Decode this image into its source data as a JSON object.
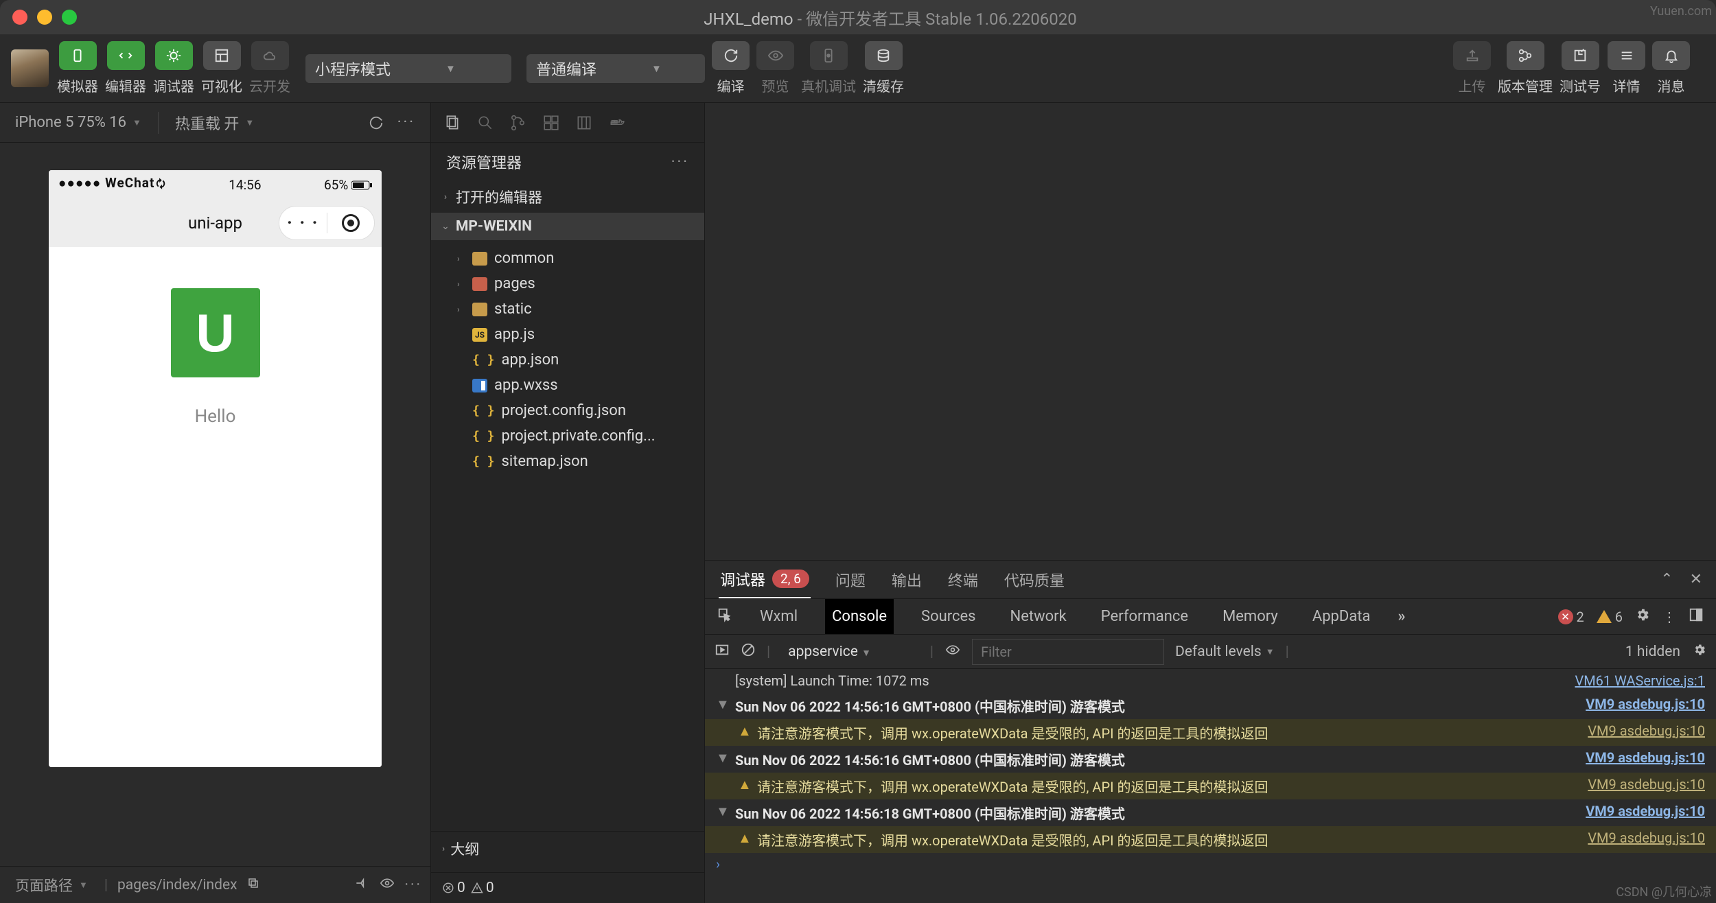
{
  "title": {
    "project": "JHXL_demo",
    "app": "微信开发者工具 Stable 1.06.2206020"
  },
  "toolbar": {
    "simulator": "模拟器",
    "editor": "编辑器",
    "debugger": "调试器",
    "visual": "可视化",
    "cloud": "云开发",
    "mode_select": "小程序模式",
    "compile_select": "普通编译",
    "compile": "编译",
    "preview": "预览",
    "realDebug": "真机调试",
    "clearCache": "清缓存",
    "upload": "上传",
    "version": "版本管理",
    "testNo": "测试号",
    "details": "详情",
    "notify": "消息"
  },
  "subbar": {
    "device": "iPhone 5 75% 16",
    "hotReload": "热重载 开"
  },
  "phone": {
    "signal": "●●●●● WeChat",
    "time": "14:56",
    "battery": "65%",
    "title": "uni-app",
    "logoLetter": "U",
    "bodyText": "Hello"
  },
  "simFooter": {
    "pagePath": "页面路径",
    "pathValue": "pages/index/index"
  },
  "explorer": {
    "title": "资源管理器",
    "openEditors": "打开的编辑器",
    "project": "MP-WEIXIN",
    "tree": {
      "common": "common",
      "pages": "pages",
      "static": "static",
      "appjs": "app.js",
      "appjson": "app.json",
      "appwxss": "app.wxss",
      "projConfig": "project.config.json",
      "projPrivate": "project.private.config...",
      "sitemap": "sitemap.json"
    },
    "outline": "大纲",
    "errors": "0",
    "warnings": "0"
  },
  "debugger": {
    "tab_debugger": "调试器",
    "badge": "2, 6",
    "tab_problems": "问题",
    "tab_output": "输出",
    "tab_terminal": "终端",
    "tab_codequality": "代码质量",
    "dev": {
      "wxml": "Wxml",
      "console": "Console",
      "sources": "Sources",
      "network": "Network",
      "performance": "Performance",
      "memory": "Memory",
      "appdata": "AppData"
    },
    "errCount": "2",
    "warnCount": "6",
    "context": "appservice",
    "filter_ph": "Filter",
    "levels": "Default levels",
    "hidden": "1 hidden"
  },
  "console": {
    "rows": [
      {
        "kind": "info",
        "txt": "[system] Launch Time: 1072 ms",
        "src": "VM61 WAService.js:1"
      },
      {
        "kind": "group",
        "arrow": "▼",
        "txt": "Sun Nov 06 2022 14:56:16 GMT+0800 (中国标准时间) 游客模式",
        "src": "VM9 asdebug.js:10"
      },
      {
        "kind": "warn",
        "txt": "请注意游客模式下，调用 wx.operateWXData 是受限的, API 的返回是工具的模拟返回",
        "src": "VM9 asdebug.js:10"
      },
      {
        "kind": "group",
        "arrow": "▼",
        "txt": "Sun Nov 06 2022 14:56:16 GMT+0800 (中国标准时间) 游客模式",
        "src": "VM9 asdebug.js:10"
      },
      {
        "kind": "warn",
        "txt": "请注意游客模式下，调用 wx.operateWXData 是受限的, API 的返回是工具的模拟返回",
        "src": "VM9 asdebug.js:10"
      },
      {
        "kind": "group",
        "arrow": "▼",
        "txt": "Sun Nov 06 2022 14:56:18 GMT+0800 (中国标准时间) 游客模式",
        "src": "VM9 asdebug.js:10"
      },
      {
        "kind": "warn",
        "txt": "请注意游客模式下，调用 wx.operateWXData 是受限的, API 的返回是工具的模拟返回",
        "src": "VM9 asdebug.js:10"
      }
    ]
  },
  "watermark": {
    "tr": "Yuuen.com",
    "br": "CSDN @几何心凉"
  }
}
